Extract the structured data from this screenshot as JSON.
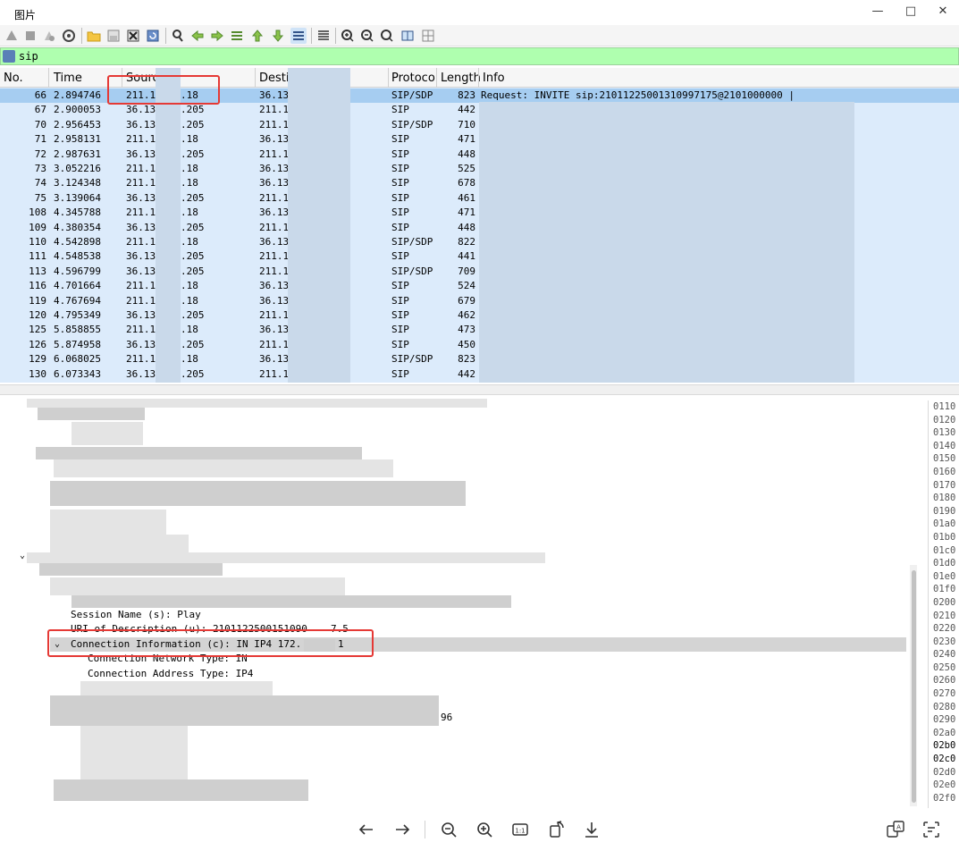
{
  "window": {
    "title": "图片"
  },
  "filter": {
    "value": "sip"
  },
  "columns": [
    "No.",
    "Time",
    "Sourc",
    "Desti",
    "Protoco",
    "Length",
    "Info"
  ],
  "packets": [
    {
      "no": "66",
      "time": "2.894746",
      "src": "211.1",
      "src_end": ".18",
      "dst": "36.13",
      "proto": "SIP/SDP",
      "len": "823",
      "info": "Request: INVITE sip:21011225001310997175@2101000000 |"
    },
    {
      "no": "67",
      "time": "2.900053",
      "src": "36.13",
      "src_end": ".205",
      "dst": "211.1",
      "proto": "SIP",
      "len": "442",
      "info": ""
    },
    {
      "no": "70",
      "time": "2.956453",
      "src": "36.13",
      "src_end": ".205",
      "dst": "211.1",
      "proto": "SIP/SDP",
      "len": "710",
      "info": ""
    },
    {
      "no": "71",
      "time": "2.958131",
      "src": "211.1",
      "src_end": ".18",
      "dst": "36.13",
      "proto": "SIP",
      "len": "471",
      "info": ""
    },
    {
      "no": "72",
      "time": "2.987631",
      "src": "36.13",
      "src_end": ".205",
      "dst": "211.1",
      "proto": "SIP",
      "len": "448",
      "info": ""
    },
    {
      "no": "73",
      "time": "3.052216",
      "src": "211.1",
      "src_end": ".18",
      "dst": "36.13",
      "proto": "SIP",
      "len": "525",
      "info": ""
    },
    {
      "no": "74",
      "time": "3.124348",
      "src": "211.1",
      "src_end": ".18",
      "dst": "36.13",
      "proto": "SIP",
      "len": "678",
      "info": ""
    },
    {
      "no": "75",
      "time": "3.139064",
      "src": "36.13",
      "src_end": ".205",
      "dst": "211.1",
      "proto": "SIP",
      "len": "461",
      "info": ""
    },
    {
      "no": "108",
      "time": "4.345788",
      "src": "211.1",
      "src_end": ".18",
      "dst": "36.13",
      "proto": "SIP",
      "len": "471",
      "info": ""
    },
    {
      "no": "109",
      "time": "4.380354",
      "src": "36.13",
      "src_end": ".205",
      "dst": "211.1",
      "proto": "SIP",
      "len": "448",
      "info": ""
    },
    {
      "no": "110",
      "time": "4.542898",
      "src": "211.1",
      "src_end": ".18",
      "dst": "36.13",
      "proto": "SIP/SDP",
      "len": "822",
      "info": ""
    },
    {
      "no": "111",
      "time": "4.548538",
      "src": "36.13",
      "src_end": ".205",
      "dst": "211.1",
      "proto": "SIP",
      "len": "441",
      "info": ""
    },
    {
      "no": "113",
      "time": "4.596799",
      "src": "36.13",
      "src_end": ".205",
      "dst": "211.1",
      "proto": "SIP/SDP",
      "len": "709",
      "info": ""
    },
    {
      "no": "116",
      "time": "4.701664",
      "src": "211.1",
      "src_end": ".18",
      "dst": "36.13",
      "proto": "SIP",
      "len": "524",
      "info": ""
    },
    {
      "no": "119",
      "time": "4.767694",
      "src": "211.1",
      "src_end": ".18",
      "dst": "36.13",
      "proto": "SIP",
      "len": "679",
      "info": ""
    },
    {
      "no": "120",
      "time": "4.795349",
      "src": "36.13",
      "src_end": ".205",
      "dst": "211.1",
      "proto": "SIP",
      "len": "462",
      "info": ""
    },
    {
      "no": "125",
      "time": "5.858855",
      "src": "211.1",
      "src_end": ".18",
      "dst": "36.13",
      "proto": "SIP",
      "len": "473",
      "info": ""
    },
    {
      "no": "126",
      "time": "5.874958",
      "src": "36.13",
      "src_end": ".205",
      "dst": "211.1",
      "proto": "SIP",
      "len": "450",
      "info": ""
    },
    {
      "no": "129",
      "time": "6.068025",
      "src": "211.1",
      "src_end": ".18",
      "dst": "36.13",
      "proto": "SIP/SDP",
      "len": "823",
      "info": ""
    },
    {
      "no": "130",
      "time": "6.073343",
      "src": "36.13",
      "src_end": ".205",
      "dst": "211.1",
      "proto": "SIP",
      "len": "442",
      "info": ""
    }
  ],
  "details": {
    "session_name": "Session Name (s): Play",
    "uri": "URI of Description (u): 2101122500151090",
    "uri_tail": "7.5",
    "conn_info": "Connection Information (c): IN IP4 172.",
    "conn_info_tail": "1",
    "net_type": "Connection Network Type: IN",
    "addr_type": "Connection Address Type: IP4",
    "trailing": "96"
  },
  "hex_offsets": [
    "0110",
    "0120",
    "0130",
    "0140",
    "0150",
    "0160",
    "0170",
    "0180",
    "0190",
    "01a0",
    "01b0",
    "01c0",
    "01d0",
    "01e0",
    "01f0",
    "0200",
    "0210",
    "0220",
    "0230",
    "0240",
    "0250",
    "0260",
    "0270",
    "0280",
    "0290",
    "02a0",
    "02b0",
    "02c0",
    "02d0",
    "02e0",
    "02f0"
  ],
  "colors": {
    "filter_bg": "#afffaf",
    "selected_row": "#a6cdf1",
    "list_bg": "#dcebfb",
    "highlight_box": "#e53935"
  }
}
